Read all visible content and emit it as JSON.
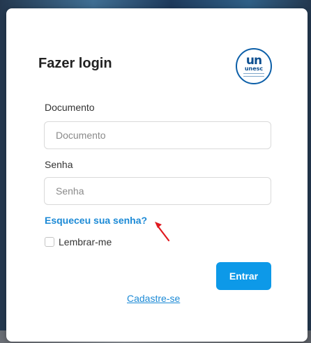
{
  "login": {
    "title": "Fazer login",
    "logo": {
      "main": "un",
      "sub": "unesc"
    },
    "document": {
      "label": "Documento",
      "placeholder": "Documento",
      "value": ""
    },
    "password": {
      "label": "Senha",
      "placeholder": "Senha",
      "value": ""
    },
    "forgot_link": "Esqueceu sua senha?",
    "remember_label": "Lembrar-me",
    "remember_checked": false,
    "submit_label": "Entrar",
    "signup_link": "Cadastre-se"
  },
  "colors": {
    "accent": "#0d99e8",
    "link": "#1c8ad6",
    "logo_blue": "#0b4e8f",
    "annotation_arrow": "#e0191f"
  },
  "icons": {
    "logo": "unesc-logo-icon",
    "annotation": "red-arrow-icon"
  }
}
